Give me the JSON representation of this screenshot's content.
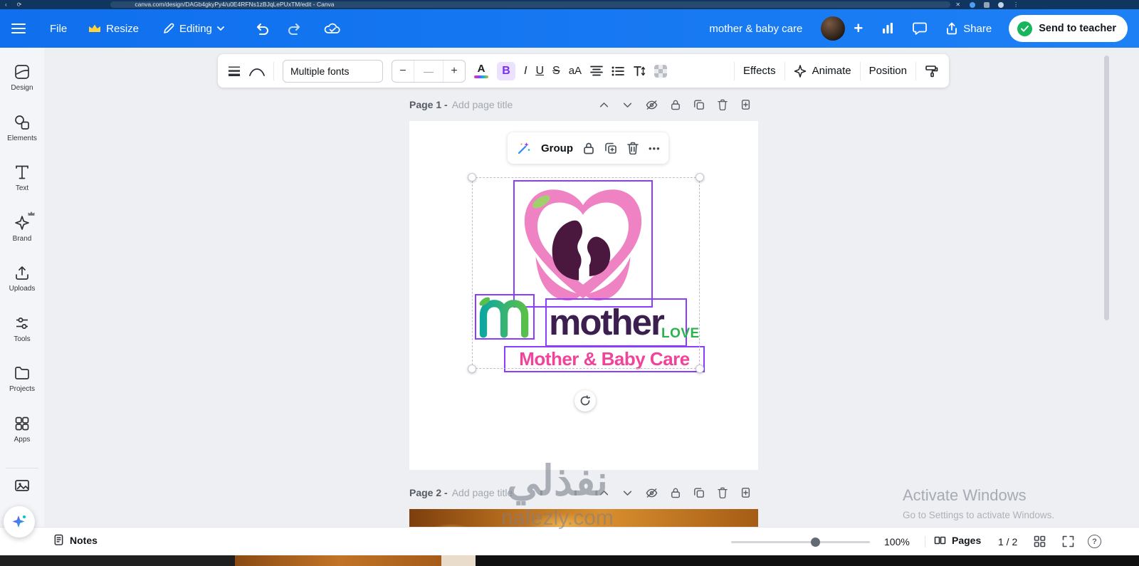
{
  "browser": {
    "url": "canva.com/design/DAGb4gkyPy4/u0E4RFNs1zBJqLePUxTM/edit - Canva",
    "close": "✕",
    "menu": "⋮"
  },
  "header": {
    "file": "File",
    "resize": "Resize",
    "editing": "Editing",
    "title": "mother & baby care",
    "plus": "+",
    "share": "Share",
    "send_to_teacher": "Send to teacher"
  },
  "toolbar": {
    "font_name": "Multiple fonts",
    "size_minus": "−",
    "size_value": "—",
    "size_plus": "+",
    "color_letter": "A",
    "bold": "B",
    "italic": "I",
    "underline": "U",
    "strikethrough": "S",
    "case_toggle": "aA",
    "effects": "Effects",
    "animate": "Animate",
    "position": "Position"
  },
  "sidebar": {
    "items": [
      {
        "label": "Design"
      },
      {
        "label": "Elements"
      },
      {
        "label": "Text"
      },
      {
        "label": "Brand"
      },
      {
        "label": "Uploads"
      },
      {
        "label": "Tools"
      },
      {
        "label": "Projects"
      },
      {
        "label": "Apps"
      }
    ]
  },
  "pages": {
    "page1": {
      "label": "Page 1 -",
      "title_placeholder": "Add page title"
    },
    "page2": {
      "label": "Page 2 -",
      "title_placeholder": "Add page title"
    }
  },
  "selection": {
    "group": "Group",
    "more": "•••"
  },
  "logo": {
    "mother": "mother",
    "love": "LOVE",
    "tagline": "Mother & Baby Care"
  },
  "watermark": {
    "arabic": "نفذلي",
    "site": "nafezly.com"
  },
  "status": {
    "notes": "Notes",
    "zoom": "100%",
    "pages": "Pages",
    "page_indicator": "1 / 2",
    "help": "?"
  },
  "windows": {
    "line1": "Activate Windows",
    "line2": "Go to Settings to activate Windows."
  },
  "colors": {
    "header_blue": "#1574f0",
    "canva_purple": "#8b3dff",
    "logo_pink": "#ee82c3",
    "logo_plum": "#4a173f",
    "logo_text_purple": "#3b1f4e",
    "logo_green": "#2bb14e",
    "logo_magenta": "#f2439b",
    "send_green": "#18b65c"
  }
}
